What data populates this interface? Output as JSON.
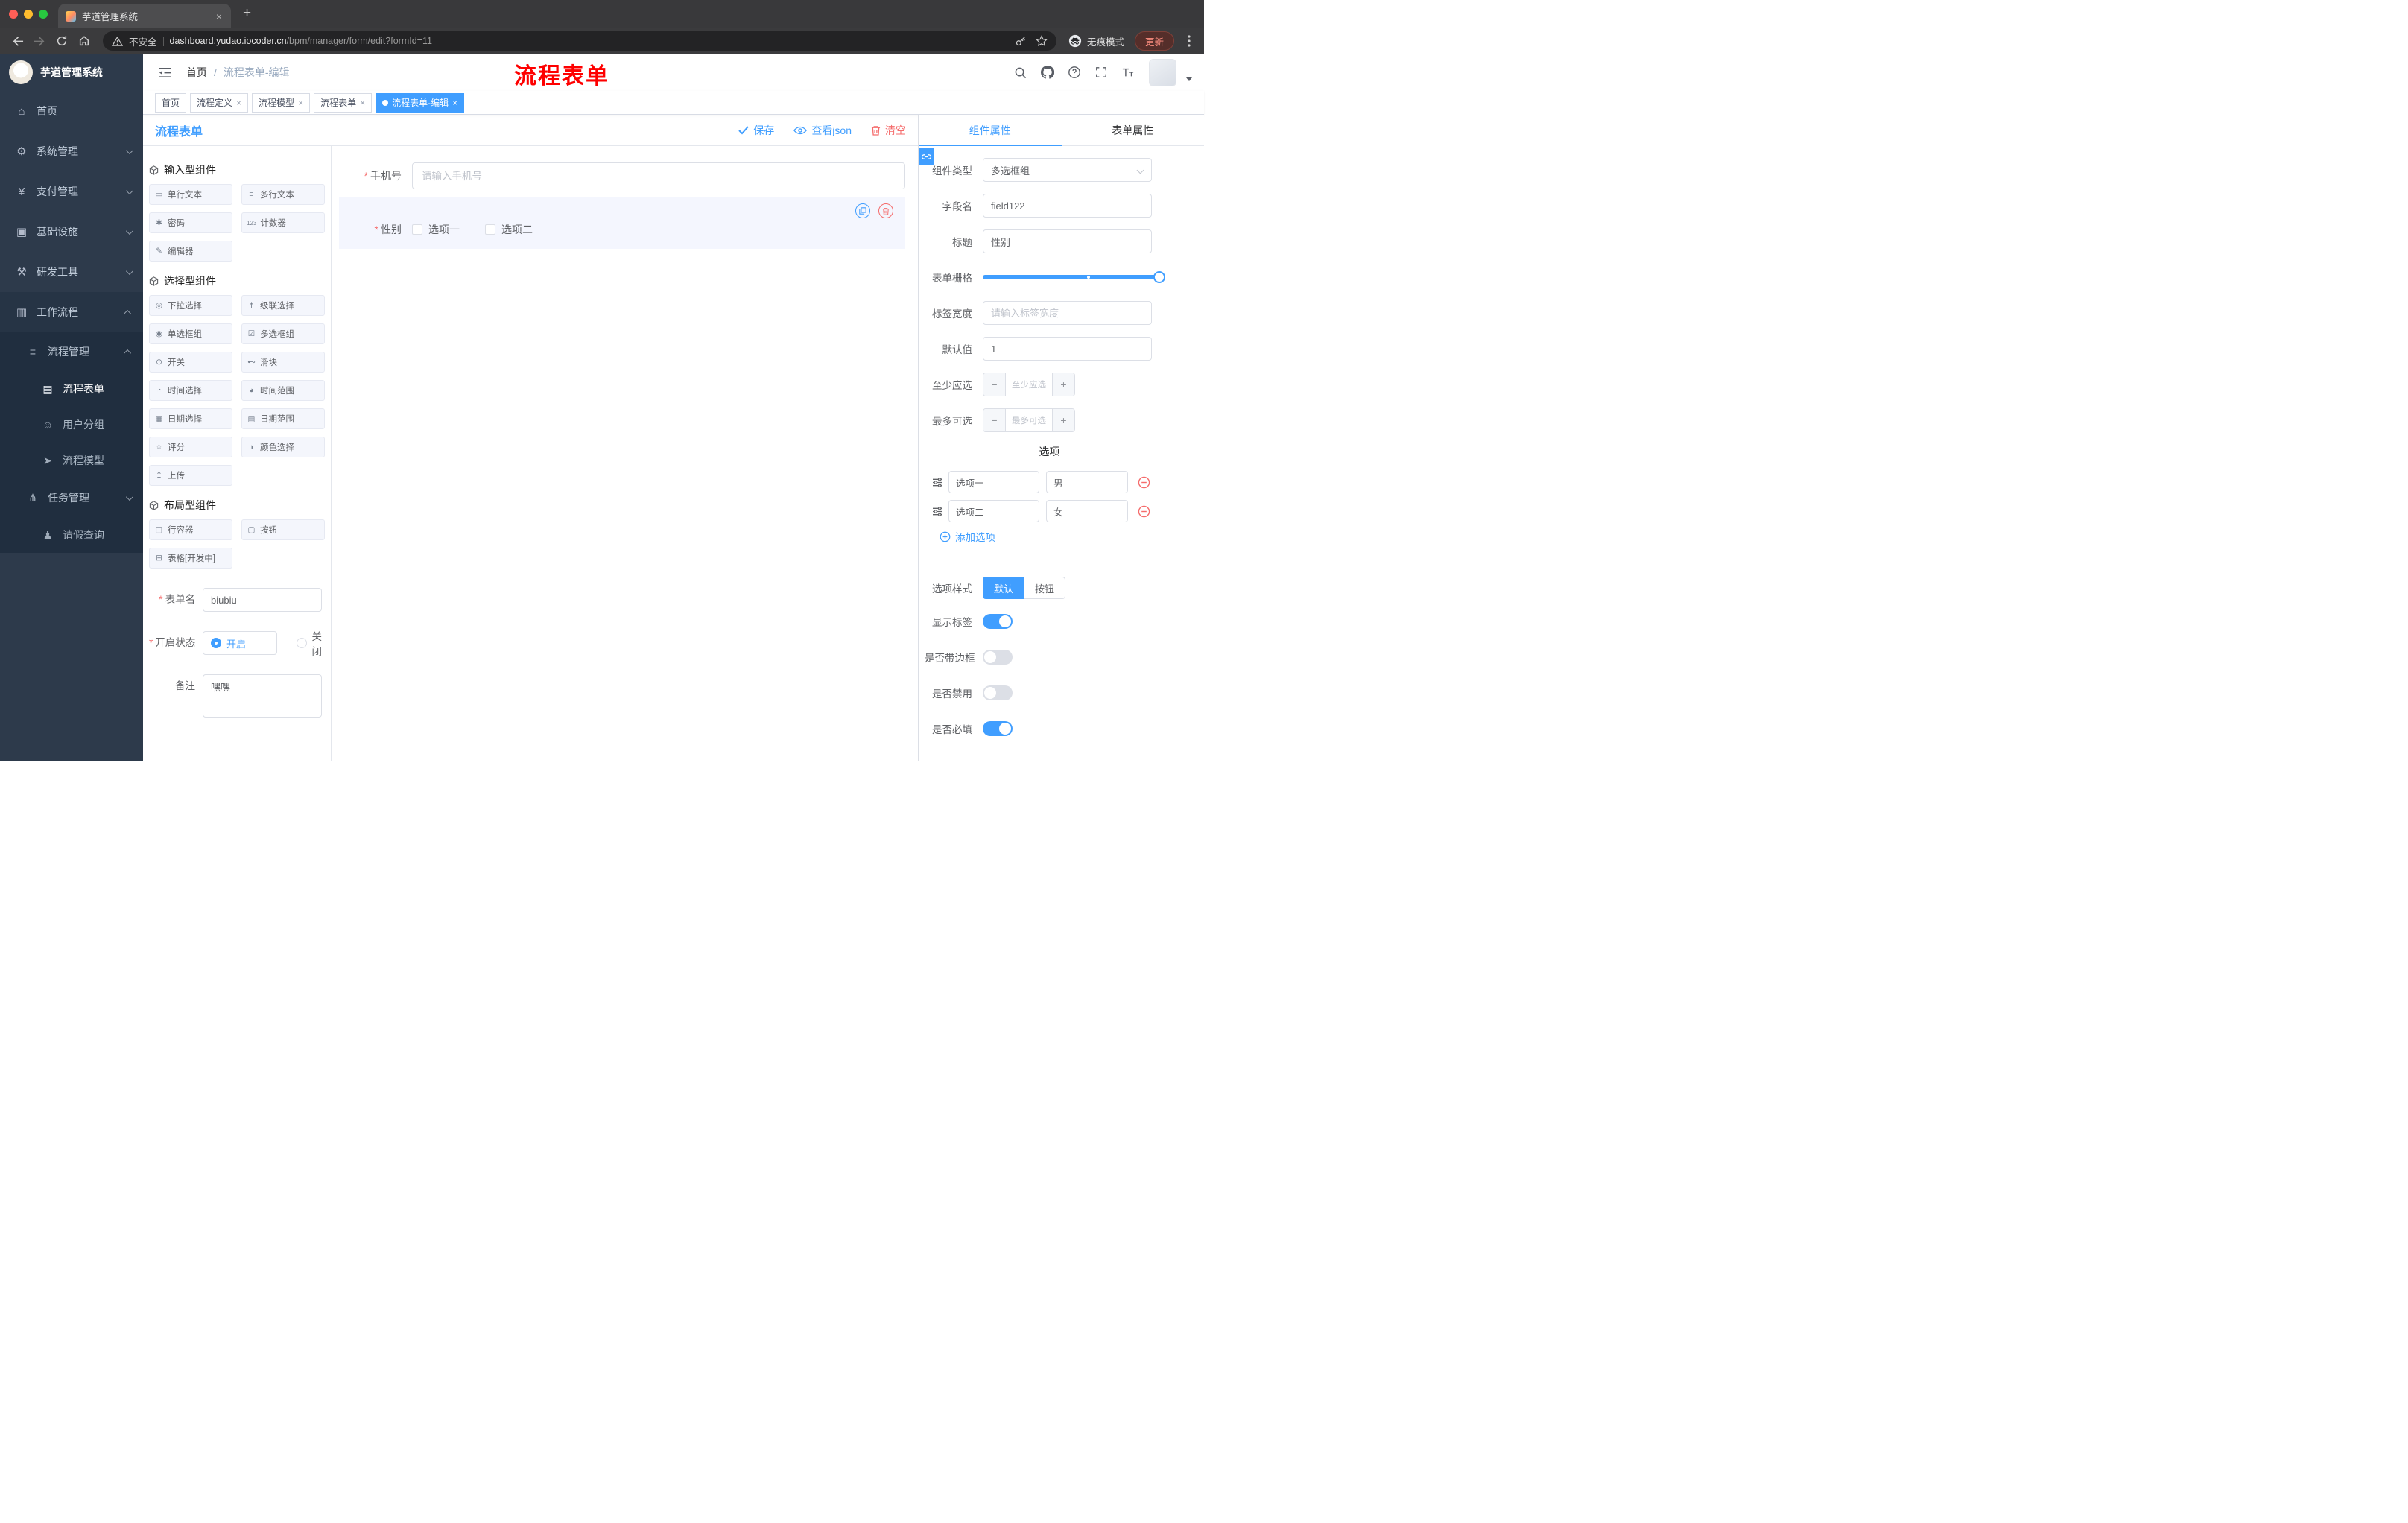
{
  "colors": {
    "accent": "#409eff",
    "danger": "#f56c6c",
    "annotation": "#fe0000"
  },
  "icons": {
    "close": "×",
    "plus": "+",
    "minus": "−"
  },
  "browser": {
    "tab_title": "芋道管理系统",
    "security_label": "不安全",
    "url_host": "dashboard.yudao.iocoder.cn",
    "url_path": "/bpm/manager/form/edit?formId=11",
    "incognito_label": "无痕模式",
    "update_label": "更新"
  },
  "sidebar": {
    "logo_title": "芋道管理系统",
    "items": [
      {
        "label": "首页",
        "icon": "⌂"
      },
      {
        "label": "系统管理",
        "icon": "⚙"
      },
      {
        "label": "支付管理",
        "icon": "¥"
      },
      {
        "label": "基础设施",
        "icon": "▣"
      },
      {
        "label": "研发工具",
        "icon": "⚒"
      },
      {
        "label": "工作流程",
        "icon": "▥"
      }
    ],
    "process_group": {
      "label": "流程管理",
      "icon": "≡",
      "children": [
        {
          "label": "流程表单",
          "icon": "▤"
        },
        {
          "label": "用户分组",
          "icon": "☺"
        },
        {
          "label": "流程模型",
          "icon": "➤"
        }
      ]
    },
    "task_group": {
      "label": "任务管理",
      "icon": "⋔"
    },
    "leave_item": {
      "label": "请假查询",
      "icon": "♟"
    }
  },
  "header": {
    "breadcrumb_root": "首页",
    "breadcrumb_sep": "/",
    "breadcrumb_current": "流程表单-编辑",
    "annotation": "流程表单"
  },
  "tagbar": {
    "tabs": [
      {
        "label": "首页"
      },
      {
        "label": "流程定义"
      },
      {
        "label": "流程模型"
      },
      {
        "label": "流程表单"
      },
      {
        "label": "流程表单-编辑"
      }
    ]
  },
  "designer": {
    "title": "流程表单",
    "actions": {
      "save": "保存",
      "view_json": "查看json",
      "clear": "清空"
    },
    "palette": {
      "groups": [
        {
          "title": "输入型组件",
          "items": [
            {
              "label": "单行文本",
              "icon": "▭"
            },
            {
              "label": "多行文本",
              "icon": "≡"
            },
            {
              "label": "密码",
              "icon": "✱"
            },
            {
              "label": "计数器",
              "icon": "123"
            },
            {
              "label": "编辑器",
              "icon": "✎"
            }
          ]
        },
        {
          "title": "选择型组件",
          "items": [
            {
              "label": "下拉选择",
              "icon": "◎"
            },
            {
              "label": "级联选择",
              "icon": "⋔"
            },
            {
              "label": "单选框组",
              "icon": "◉"
            },
            {
              "label": "多选框组",
              "icon": "☑"
            },
            {
              "label": "开关",
              "icon": "⊙"
            },
            {
              "label": "滑块",
              "icon": "⊷"
            },
            {
              "label": "时间选择",
              "icon": "◔"
            },
            {
              "label": "时间范围",
              "icon": "◕"
            },
            {
              "label": "日期选择",
              "icon": "▦"
            },
            {
              "label": "日期范围",
              "icon": "▤"
            },
            {
              "label": "评分",
              "icon": "☆"
            },
            {
              "label": "颜色选择",
              "icon": "◑"
            },
            {
              "label": "上传",
              "icon": "↥"
            }
          ]
        },
        {
          "title": "布局型组件",
          "items": [
            {
              "label": "行容器",
              "icon": "◫"
            },
            {
              "label": "按钮",
              "icon": "▢"
            },
            {
              "label": "表格[开发中]",
              "icon": "⊞"
            }
          ]
        }
      ],
      "meta_form": {
        "name_label": "表单名",
        "name_value": "biubiu",
        "status_label": "开启状态",
        "status_on": "开启",
        "status_off": "关闭",
        "remark_label": "备注",
        "remark_value": "嘿嘿"
      }
    },
    "canvas": {
      "phone": {
        "label": "手机号",
        "placeholder": "请输入手机号"
      },
      "gender": {
        "label": "性别",
        "options": [
          {
            "label": "选项一"
          },
          {
            "label": "选项二"
          }
        ]
      }
    },
    "props": {
      "tabs": {
        "component": "组件属性",
        "form": "表单属性"
      },
      "rows": {
        "type_label": "组件类型",
        "type_value": "多选框组",
        "field_label": "字段名",
        "field_value": "field122",
        "title_label": "标题",
        "title_value": "性别",
        "grid_label": "表单栅格",
        "labelw_label": "标签宽度",
        "labelw_placeholder": "请输入标签宽度",
        "default_label": "默认值",
        "default_value": "1",
        "min_label": "至少应选",
        "min_placeholder": "至少应选",
        "max_label": "最多可选",
        "max_placeholder": "最多可选"
      },
      "options": {
        "divider": "选项",
        "rows": [
          {
            "label": "选项一",
            "value": "男"
          },
          {
            "label": "选项二",
            "value": "女"
          }
        ],
        "add": "添加选项"
      },
      "style": {
        "label": "选项样式",
        "default_btn": "默认",
        "button_btn": "按钮",
        "toggles": [
          {
            "label": "显示标签",
            "on": true
          },
          {
            "label": "是否带边框",
            "on": false
          },
          {
            "label": "是否禁用",
            "on": false
          },
          {
            "label": "是否必填",
            "on": true
          }
        ]
      }
    }
  }
}
